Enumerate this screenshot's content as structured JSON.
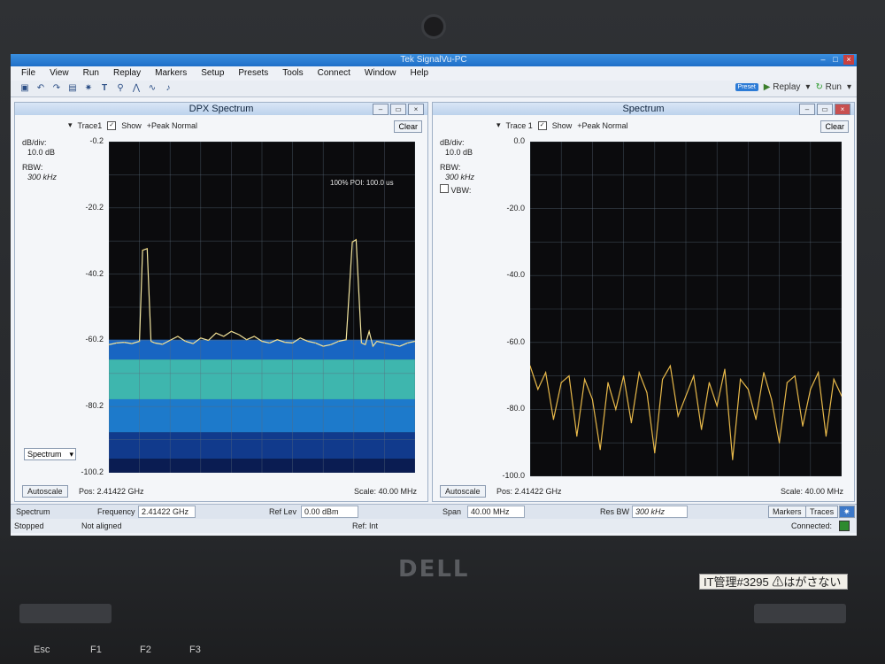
{
  "app": {
    "title": "Tek SignalVu-PC",
    "menu": [
      "File",
      "View",
      "Run",
      "Replay",
      "Markers",
      "Setup",
      "Presets",
      "Tools",
      "Connect",
      "Window",
      "Help"
    ],
    "toolbar": {
      "preset_chip": "Preset",
      "replay_label": "Replay",
      "run_label": "Run"
    }
  },
  "dpx": {
    "title": "DPX Spectrum",
    "trace": "Trace1",
    "show_label": "Show",
    "detector": "+Peak Normal",
    "clear": "Clear",
    "db_div_label": "dB/div:",
    "db_div_value": "10.0 dB",
    "rbw_label": "RBW:",
    "rbw_value": "300 kHz",
    "poi_text": "100% POI: 100.0 us",
    "view_select": "Spectrum",
    "autoscale": "Autoscale",
    "pos": "Pos: 2.41422 GHz",
    "scale": "Scale: 40.00 MHz"
  },
  "spectrum": {
    "title": "Spectrum",
    "trace": "Trace 1",
    "show_label": "Show",
    "detector": "+Peak Normal",
    "clear": "Clear",
    "db_div_label": "dB/div:",
    "db_div_value": "10.0 dB",
    "rbw_label": "RBW:",
    "rbw_value": "300 kHz",
    "vbw_label": "VBW:",
    "autoscale": "Autoscale",
    "pos": "Pos: 2.41422 GHz",
    "scale": "Scale: 40.00 MHz"
  },
  "status": {
    "measure": "Spectrum",
    "frequency_label": "Frequency",
    "frequency_value": "2.41422 GHz",
    "reflev_label": "Ref Lev",
    "reflev_value": "0.00 dBm",
    "span_label": "Span",
    "span_value": "40.00 MHz",
    "resbw_label": "Res BW",
    "resbw_value": "300 kHz",
    "markers_btn": "Markers",
    "traces_btn": "Traces",
    "state": "Stopped",
    "align": "Not aligned",
    "ref": "Ref: Int",
    "connected": "Connected:"
  },
  "hardware": {
    "brand": "DELL",
    "sticker": "IT管理#3295 ⚠はがさない",
    "keys": [
      "Esc",
      "F1",
      "F2",
      "F3"
    ]
  },
  "chart_data": [
    {
      "type": "line",
      "title": "DPX Spectrum",
      "ylabel": "dB/div: 10.0 dB",
      "yticks": [
        "-0.2",
        "-20.2",
        "-40.2",
        "-60.2",
        "-80.2",
        "-100.2"
      ],
      "ylim": [
        -100.2,
        -0.2
      ],
      "x_center_ghz": 2.41422,
      "x_span_mhz": 40,
      "series": [
        {
          "name": "Trace1",
          "x_mhz": [
            -20,
            -19,
            -18,
            -17,
            -16,
            -15.6,
            -15,
            -14.5,
            -14,
            -13,
            -12,
            -11,
            -10,
            -9,
            -8,
            -7,
            -6,
            -5,
            -4,
            -3,
            -2,
            -1,
            0,
            1,
            2,
            3,
            4,
            5,
            6,
            7,
            8,
            9,
            10,
            11,
            11.8,
            12.3,
            13,
            13.5,
            14,
            14.5,
            15,
            16,
            17,
            18,
            19,
            20
          ],
          "y_db": [
            -61.5,
            -61,
            -60.8,
            -61.2,
            -60.5,
            -33,
            -32.5,
            -60.5,
            -61,
            -61.4,
            -60.2,
            -59,
            -60.5,
            -61.2,
            -59.5,
            -60.2,
            -58,
            -59,
            -57.5,
            -58.5,
            -60,
            -59,
            -60.5,
            -61,
            -60,
            -60.8,
            -61,
            -59.5,
            -60.5,
            -61,
            -62,
            -61.5,
            -60.5,
            -60,
            -30.5,
            -29.8,
            -61,
            -61.5,
            -57.5,
            -62,
            -60.5,
            -61,
            -61.5,
            -62,
            -61,
            -60.5
          ]
        }
      ]
    },
    {
      "type": "line",
      "title": "Spectrum",
      "ylabel": "dB/div: 10.0 dB",
      "yticks": [
        "0.0",
        "-20.0",
        "-40.0",
        "-60.0",
        "-80.0",
        "-100.0"
      ],
      "ylim": [
        -100,
        0
      ],
      "x_center_ghz": 2.41422,
      "x_span_mhz": 40,
      "series": [
        {
          "name": "Trace 1",
          "x_mhz": [
            -20,
            -19,
            -18,
            -17,
            -16,
            -15,
            -14,
            -13,
            -12,
            -11,
            -10,
            -9,
            -8,
            -7,
            -6,
            -5,
            -4,
            -3,
            -2,
            -1,
            0,
            1,
            2,
            3,
            4,
            5,
            6,
            7,
            8,
            9,
            10,
            11,
            12,
            13,
            14,
            15,
            16,
            17,
            18,
            19,
            20
          ],
          "y_db": [
            -67,
            -74,
            -69,
            -83,
            -72,
            -70,
            -88,
            -71,
            -77,
            -92,
            -72,
            -80,
            -70,
            -84,
            -69,
            -75,
            -93,
            -71,
            -67,
            -82,
            -76,
            -70,
            -86,
            -72,
            -79,
            -68,
            -95,
            -71,
            -74,
            -83,
            -69,
            -77,
            -90,
            -72,
            -70,
            -85,
            -74,
            -69,
            -88,
            -71,
            -76
          ]
        }
      ]
    }
  ]
}
